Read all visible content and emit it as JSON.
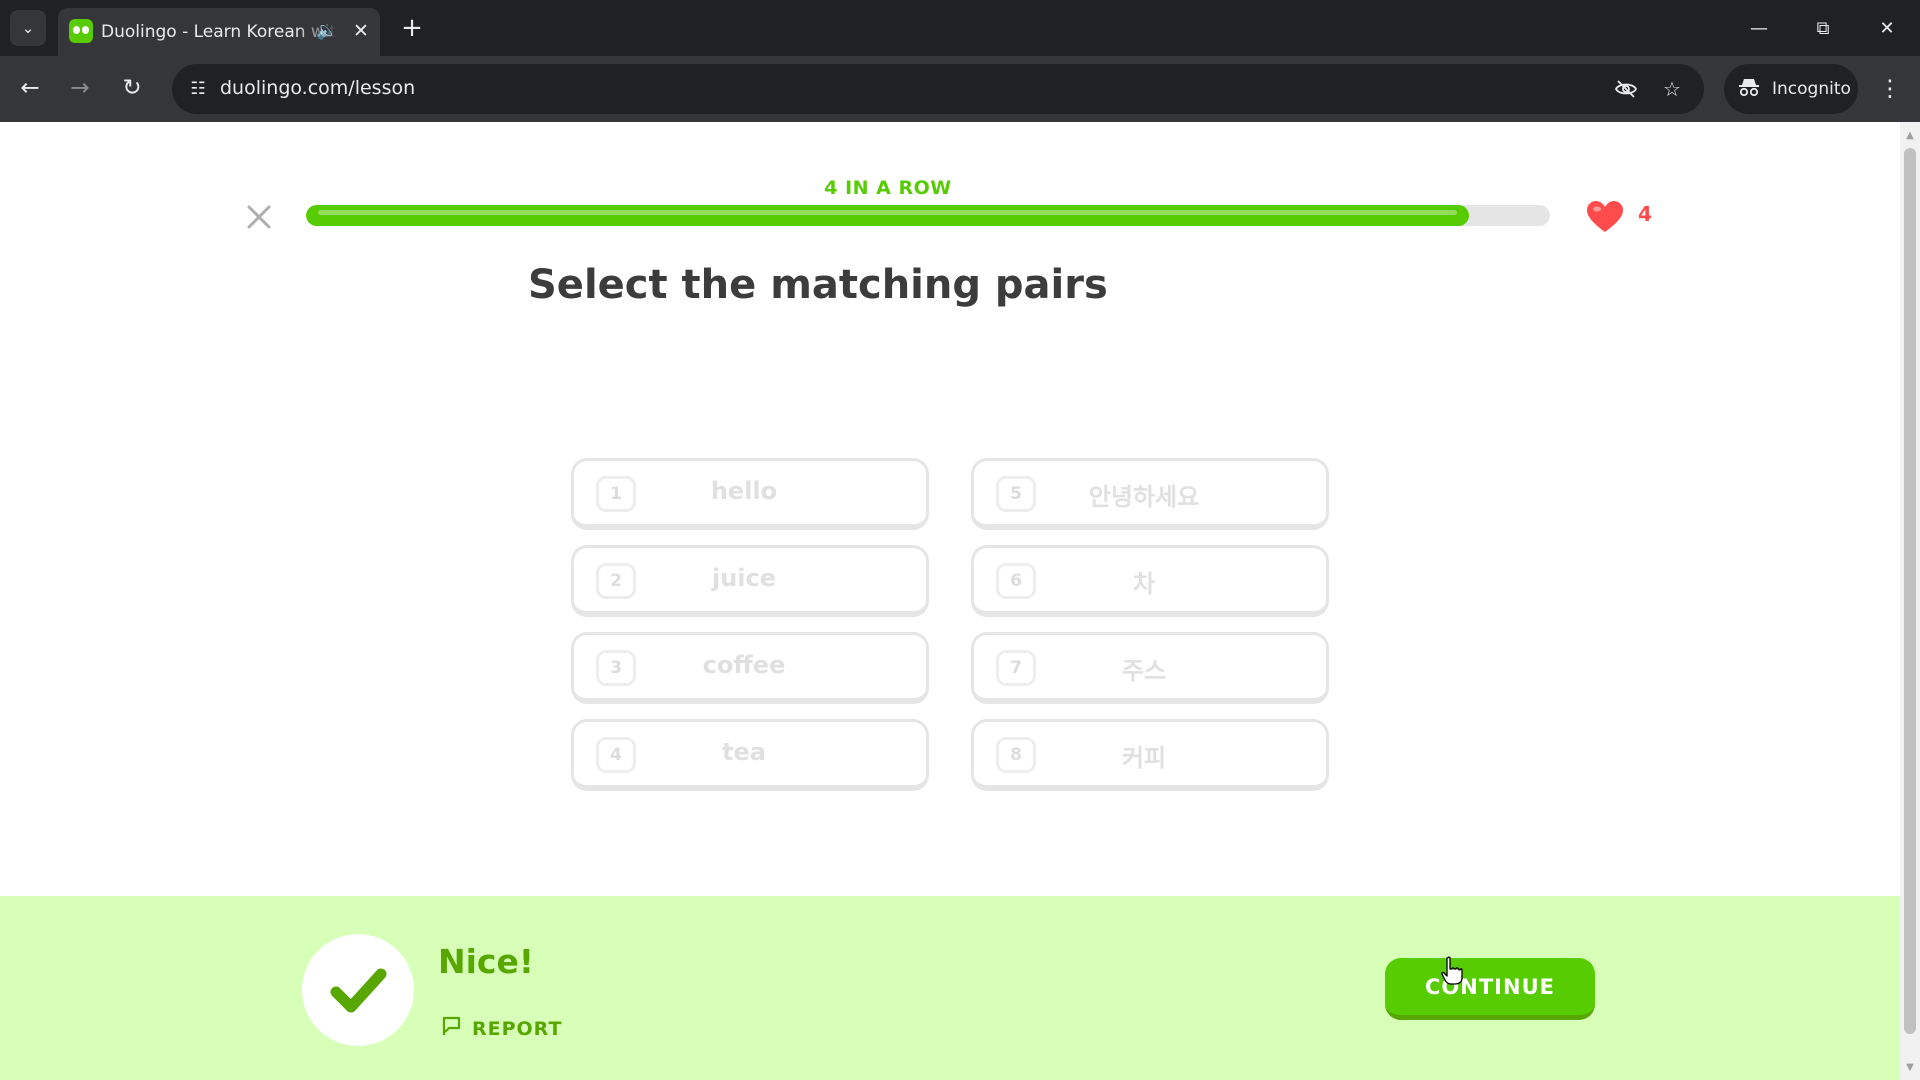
{
  "browser": {
    "tab_title": "Duolingo - Learn Korean with lessons",
    "url": "duolingo.com/lesson",
    "incognito_label": "Incognito",
    "icons": {
      "tab_search": "chevron-down-icon",
      "favicon": "duolingo-owl-icon",
      "audio": "speaker-icon",
      "tab_close": "close-icon",
      "new_tab": "plus-icon",
      "minimize": "minimize-icon",
      "restore": "restore-icon",
      "close": "close-icon",
      "back": "arrow-left-icon",
      "forward": "arrow-right-icon",
      "reload": "reload-icon",
      "site_info": "tune-icon",
      "eye_off": "eye-off-icon",
      "bookmark": "star-icon",
      "incognito": "incognito-icon",
      "menu": "more-vert-icon"
    }
  },
  "lesson": {
    "streak_label": "4 IN A ROW",
    "progress_fraction": 0.935,
    "hearts": "4",
    "prompt": "Select the matching pairs",
    "left_column": [
      {
        "num": "1",
        "text": "hello"
      },
      {
        "num": "2",
        "text": "juice"
      },
      {
        "num": "3",
        "text": "coffee"
      },
      {
        "num": "4",
        "text": "tea"
      }
    ],
    "right_column": [
      {
        "num": "5",
        "text": "안녕하세요"
      },
      {
        "num": "6",
        "text": "차"
      },
      {
        "num": "7",
        "text": "주스"
      },
      {
        "num": "8",
        "text": "커피"
      }
    ]
  },
  "feedback": {
    "title": "Nice!",
    "report_label": "REPORT",
    "continue_label": "CONTINUE"
  },
  "colors": {
    "brand_green": "#58cc02",
    "dark_green": "#58a700",
    "feedback_bg": "#d7ffb8",
    "heart_red": "#ff4b4b",
    "text_dark": "#3c3c3c"
  }
}
